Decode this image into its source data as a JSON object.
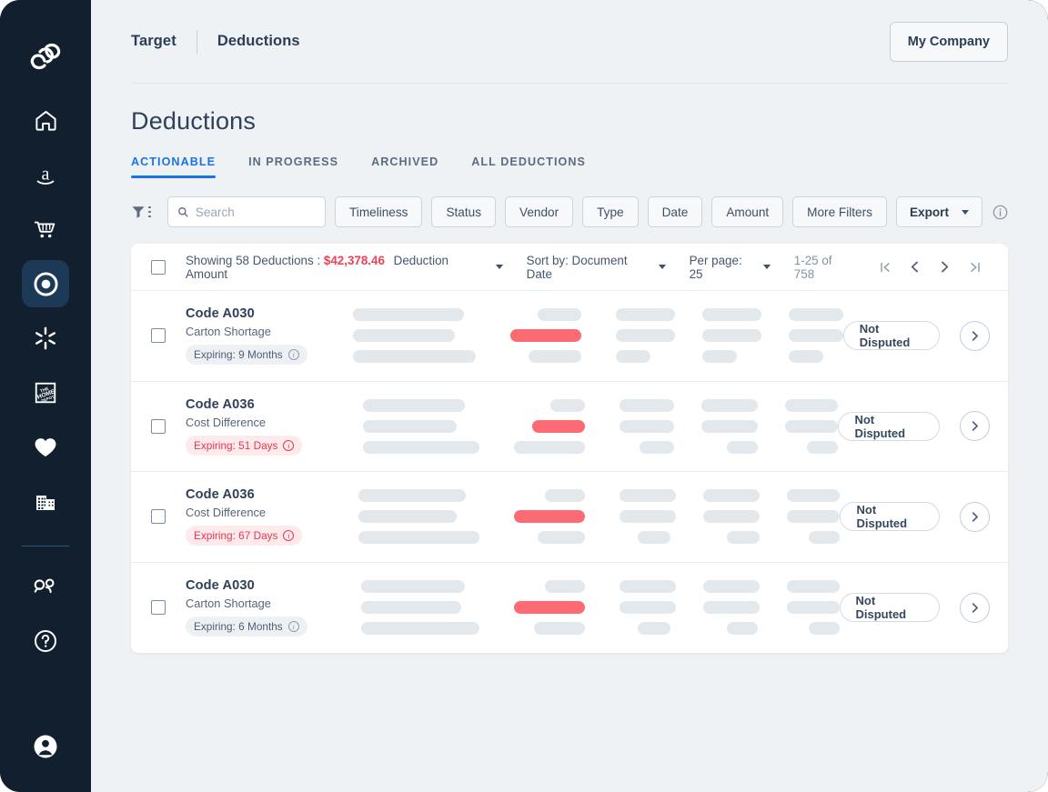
{
  "sidebar": {
    "logo": "knot-logo-icon",
    "items": [
      {
        "name": "home",
        "icon": "home-icon",
        "active": false
      },
      {
        "name": "amazon",
        "icon": "amazon-icon",
        "active": false
      },
      {
        "name": "walmart-cart",
        "icon": "shopping-cart-icon",
        "active": false
      },
      {
        "name": "target",
        "icon": "target-bullseye-icon",
        "active": true
      },
      {
        "name": "walmart-spark",
        "icon": "spark-icon",
        "active": false
      },
      {
        "name": "home-depot",
        "icon": "home-depot-icon",
        "active": false
      },
      {
        "name": "favorites",
        "icon": "heart-icon",
        "active": false
      },
      {
        "name": "company",
        "icon": "building-icon",
        "active": false
      }
    ],
    "secondary": [
      {
        "name": "team",
        "icon": "people-icon"
      },
      {
        "name": "help",
        "icon": "question-circle-icon"
      }
    ],
    "account": {
      "name": "account",
      "icon": "user-circle-icon"
    }
  },
  "header": {
    "breadcrumb_root": "Target",
    "breadcrumb_current": "Deductions",
    "company_button": "My Company"
  },
  "page": {
    "title": "Deductions"
  },
  "tabs": [
    {
      "label": "ACTIONABLE",
      "active": true
    },
    {
      "label": "IN PROGRESS",
      "active": false
    },
    {
      "label": "ARCHIVED",
      "active": false
    },
    {
      "label": "ALL DEDUCTIONS",
      "active": false
    }
  ],
  "filters": {
    "funnel_icon": "filter-funnel-icon",
    "search_placeholder": "Search",
    "search_value": "",
    "chips": [
      "Timeliness",
      "Status",
      "Vendor",
      "Type",
      "Date",
      "Amount",
      "More Filters"
    ],
    "export_label": "Export",
    "info_icon": "info-circle-icon"
  },
  "toolbar": {
    "showing_prefix": "Showing 58 Deductions",
    "separator": ":",
    "amount": "$42,378.46",
    "amount_label": "Deduction Amount",
    "amount_color": "#ef4056",
    "sort_label": "Sort by: Document Date",
    "per_page_label": "Per page: 25",
    "range": "1-25 of 758",
    "pagination": {
      "first": "|<",
      "prev": "<",
      "next": ">",
      "last": ">|"
    }
  },
  "rows": [
    {
      "code": "Code A030",
      "description": "Carton Shortage",
      "expiring": "Expiring: 9 Months",
      "expiring_style": "neutral",
      "status": "Not Disputed",
      "chevron": "chevron-right-icon"
    },
    {
      "code": "Code A036",
      "description": "Cost Difference",
      "expiring": "Expiring: 51 Days",
      "expiring_style": "warn",
      "status": "Not Disputed",
      "chevron": "chevron-right-icon"
    },
    {
      "code": "Code A036",
      "description": "Cost Difference",
      "expiring": "Expiring: 67 Days",
      "expiring_style": "warn",
      "status": "Not Disputed",
      "chevron": "chevron-right-icon"
    },
    {
      "code": "Code A030",
      "description": "Carton Shortage",
      "expiring": "Expiring: 6 Months",
      "expiring_style": "neutral",
      "status": "Not Disputed",
      "chevron": "chevron-right-icon"
    }
  ],
  "theme": {
    "accent": "#1a73e8",
    "danger": "#ef4056",
    "sidebar_bg": "#111f2e",
    "page_bg": "#eef2f5"
  }
}
